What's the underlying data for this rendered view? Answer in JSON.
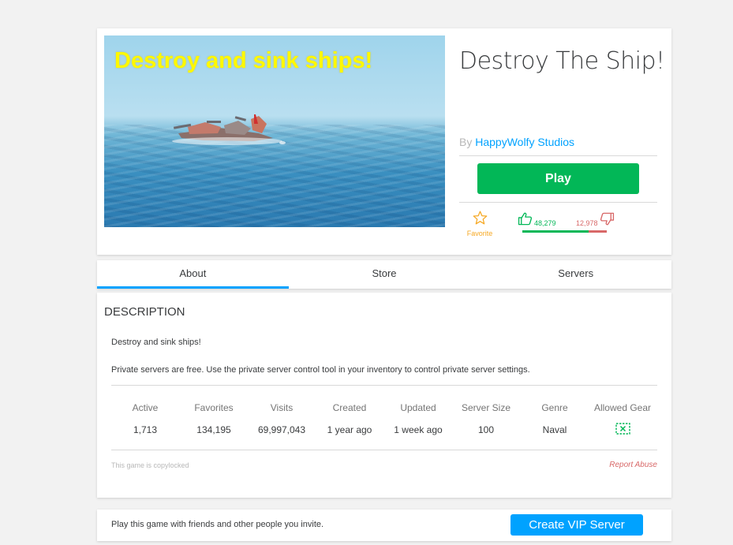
{
  "game": {
    "thumbnail_caption": "Destroy and sink ships!",
    "title": "Destroy The Ship!",
    "by_label": "By",
    "creator": "HappyWolfy Studios",
    "play_label": "Play",
    "favorite_label": "Favorite",
    "upvotes": "48,279",
    "downvotes": "12,978",
    "upvote_fraction": 0.788
  },
  "tabs": [
    {
      "label": "About",
      "active": true
    },
    {
      "label": "Store",
      "active": false
    },
    {
      "label": "Servers",
      "active": false
    }
  ],
  "about": {
    "heading": "DESCRIPTION",
    "description_lines": [
      "Destroy and sink ships!",
      "Private servers are free. Use the private server control tool in your inventory to control private server settings."
    ],
    "stats": [
      {
        "label": "Active",
        "value": "1,713"
      },
      {
        "label": "Favorites",
        "value": "134,195"
      },
      {
        "label": "Visits",
        "value": "69,997,043"
      },
      {
        "label": "Created",
        "value": "1 year ago"
      },
      {
        "label": "Updated",
        "value": "1 week ago"
      },
      {
        "label": "Server Size",
        "value": "100"
      },
      {
        "label": "Genre",
        "value": "Naval"
      },
      {
        "label": "Allowed Gear",
        "value": ""
      }
    ],
    "copylock_text": "This game is copylocked",
    "report_label": "Report Abuse"
  },
  "vip": {
    "text": "Play this game with friends and other people you invite.",
    "button_label": "Create VIP Server"
  },
  "colors": {
    "play_green": "#02b757",
    "link_blue": "#00a2ff",
    "downvote_red": "#d86868",
    "favorite_orange": "#f6a823"
  },
  "icons": [
    "star-icon",
    "thumbs-up-icon",
    "thumbs-down-icon",
    "gear-allowed-icon"
  ]
}
